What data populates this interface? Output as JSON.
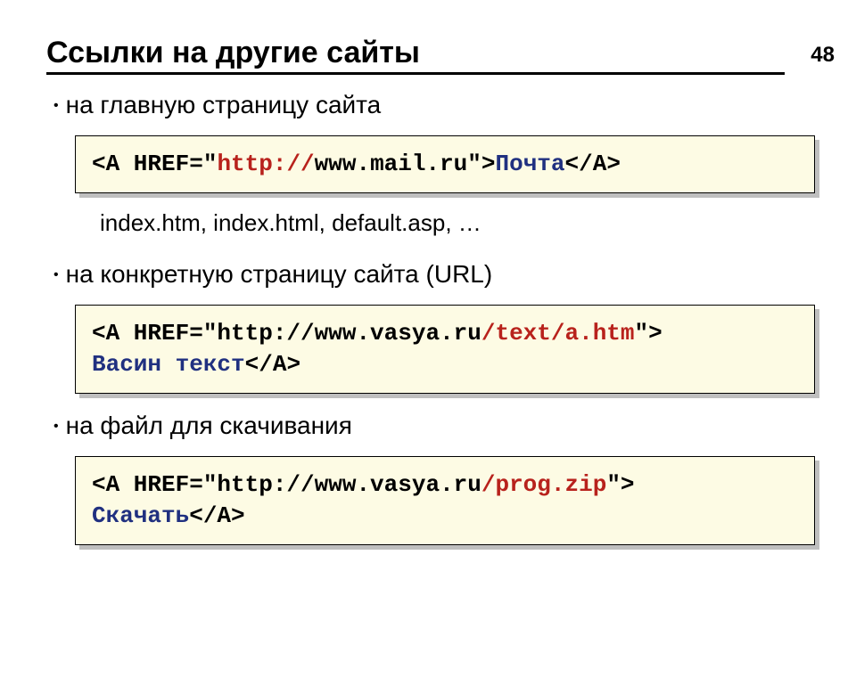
{
  "page_number": "48",
  "title": "Ссылки на другие сайты",
  "bullets": {
    "b1": "на главную страницу сайта",
    "b2": "на конкретную страницу сайта (URL)",
    "b3": "на файл для скачивания"
  },
  "index_line": "index.htm, index.html, default.asp, …",
  "code1": {
    "s1": "<A HREF=\"",
    "s2": "http://",
    "s3": "www.mail.ru\">",
    "s4": "Почта",
    "s5": "</A>"
  },
  "code2": {
    "s1": "<A HREF=\"http://www.vasya.ru",
    "s2": "/text/a.htm",
    "s3": "\">",
    "s4": "Васин текст",
    "s5": "</A>"
  },
  "code3": {
    "s1": "<A HREF=\"http://www.vasya.ru",
    "s2": "/prog.zip",
    "s3": "\">",
    "s4": "Скачать",
    "s5": "</A>"
  }
}
